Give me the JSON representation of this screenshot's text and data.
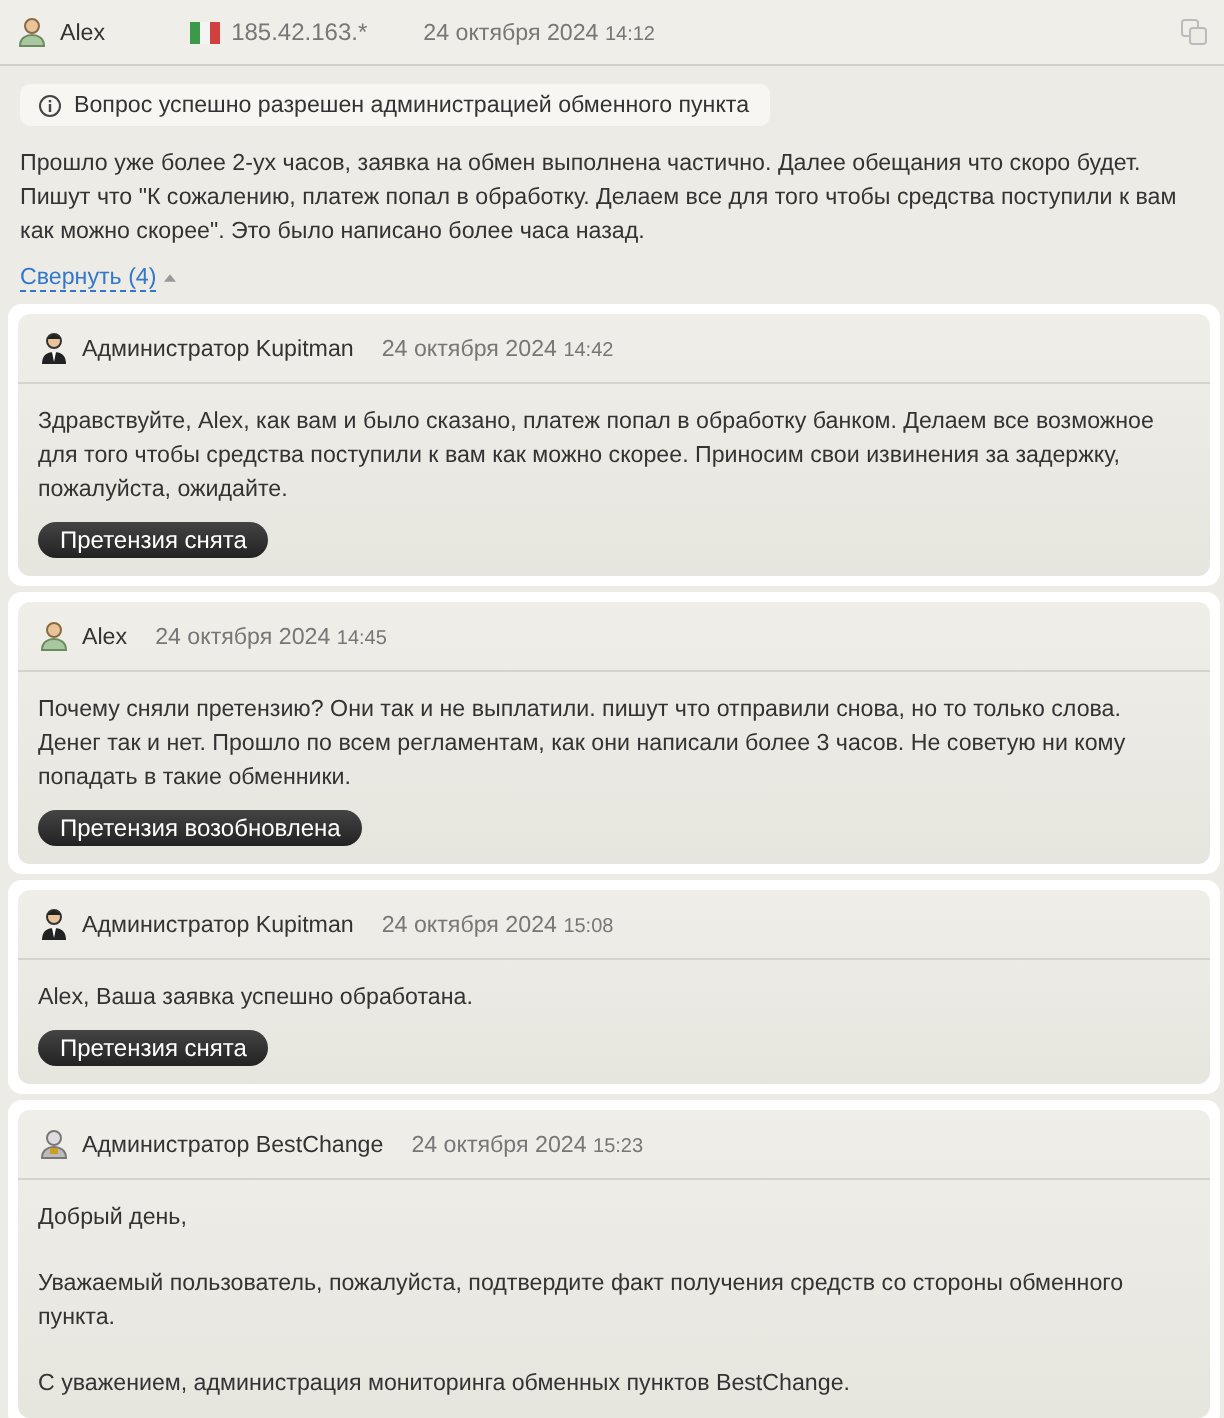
{
  "post": {
    "author": "Alex",
    "kind": "user",
    "ip": "185.42.163.*",
    "date": "24 октября 2024",
    "time": "14:12",
    "notice": "Вопрос успешно разрешен администрацией обменного пункта",
    "text": "Прошло уже более 2-ух часов, заявка на обмен выполнена частично. Далее обещания что скоро будет. Пишут что \"К сожалению, платеж попал в обработку. Делаем все для того чтобы средства поступили к вам как можно скорее\". Это было написано более часа назад.",
    "collapse": "Свернуть (4)"
  },
  "replies": [
    {
      "kind": "admin",
      "author": "Администратор Kupitman",
      "date": "24 октября 2024",
      "time": "14:42",
      "paragraphs": [
        "Здравствуйте, Alex, как вам и было сказано, платеж попал в обработку банком. Делаем все возможное для того чтобы средства поступили к вам как можно скорее. Приносим свои извинения за задержку, пожалуйста, ожидайте."
      ],
      "badge": "Претензия снята"
    },
    {
      "kind": "user",
      "author": "Alex",
      "date": "24 октября 2024",
      "time": "14:45",
      "paragraphs": [
        "Почему сняли претензию? Они так и не выплатили. пишут что отправили снова, но то только слова. Денег так и нет. Прошло по всем регламентам, как они написали более 3 часов. Не советую ни кому попадать в такие обменники."
      ],
      "badge": "Претензия возобновлена"
    },
    {
      "kind": "admin",
      "author": "Администратор Kupitman",
      "date": "24 октября 2024",
      "time": "15:08",
      "paragraphs": [
        "Alex, Ваша заявка успешно обработана."
      ],
      "badge": "Претензия снята"
    },
    {
      "kind": "moderator",
      "author": "Администратор BestChange",
      "date": "24 октября 2024",
      "time": "15:23",
      "paragraphs": [
        "Добрый день,",
        "Уважаемый пользователь, пожалуйста, подтвердите факт получения средств со стороны обменного пункта.",
        "С уважением, администрация мониторинга обменных пунктов BestChange."
      ]
    }
  ]
}
